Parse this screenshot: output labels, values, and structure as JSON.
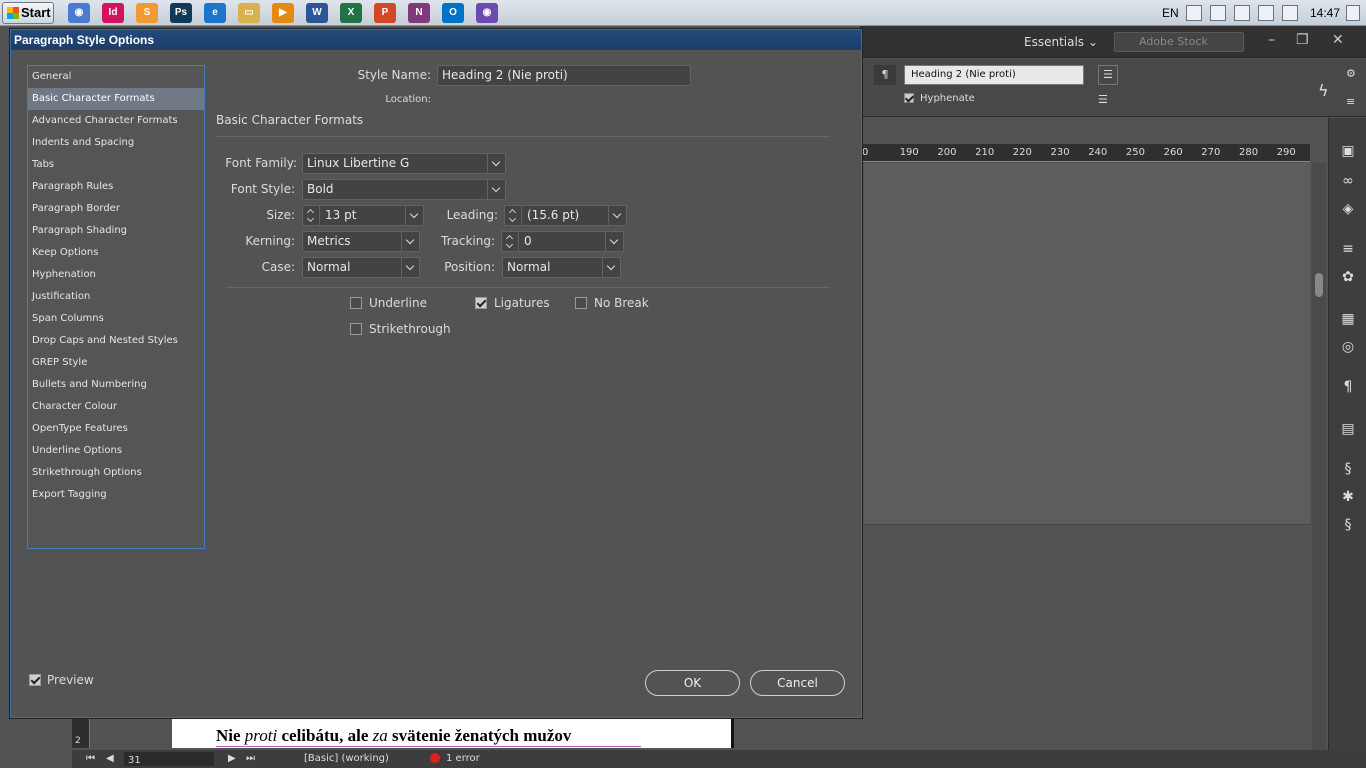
{
  "taskbar": {
    "start_label": "Start",
    "apps": [
      {
        "name": "chrome-icon",
        "glyph": "◉",
        "color": "#4a7bd0"
      },
      {
        "name": "indesign-icon",
        "glyph": "Id",
        "color": "#d4145a"
      },
      {
        "name": "sublime-icon",
        "glyph": "S",
        "color": "#f29a32"
      },
      {
        "name": "photoshop-icon",
        "glyph": "Ps",
        "color": "#0f3a5a"
      },
      {
        "name": "ie-icon",
        "glyph": "e",
        "color": "#1f75c9"
      },
      {
        "name": "explorer-icon",
        "glyph": "▭",
        "color": "#d8b24a"
      },
      {
        "name": "media-player-icon",
        "glyph": "▶",
        "color": "#e38a12"
      },
      {
        "name": "word-icon",
        "glyph": "W",
        "color": "#2b579a"
      },
      {
        "name": "excel-icon",
        "glyph": "X",
        "color": "#217346"
      },
      {
        "name": "powerpoint-icon",
        "glyph": "P",
        "color": "#d24726"
      },
      {
        "name": "onenote-icon",
        "glyph": "N",
        "color": "#80397b"
      },
      {
        "name": "outlook-icon",
        "glyph": "O",
        "color": "#0072c6"
      },
      {
        "name": "firefox-icon",
        "glyph": "◉",
        "color": "#6c4ab0"
      }
    ],
    "lang": "EN",
    "clock": "14:47"
  },
  "app": {
    "workspace": "Essentials",
    "stock_placeholder": "Adobe Stock",
    "style_name_field": "Heading 2 (Nie proti)",
    "hyphenate_label": "Hyphenate",
    "ruler_ticks": [
      "0",
      "190",
      "200",
      "210",
      "220",
      "230",
      "240",
      "250",
      "260",
      "270",
      "280",
      "290"
    ],
    "page_text_a": "Nie ",
    "page_text_b": "proti",
    "page_text_c": " celibátu, ale ",
    "page_text_d": "za",
    "page_text_e": " svätenie ženatých mužov",
    "page_number_mark": "2"
  },
  "status": {
    "page": "31",
    "style": "[Basic] (working)",
    "errors": "1 error"
  },
  "dialog": {
    "title": "Paragraph Style Options",
    "categories": [
      "General",
      "Basic Character Formats",
      "Advanced Character Formats",
      "Indents and Spacing",
      "Tabs",
      "Paragraph Rules",
      "Paragraph Border",
      "Paragraph Shading",
      "Keep Options",
      "Hyphenation",
      "Justification",
      "Span Columns",
      "Drop Caps and Nested Styles",
      "GREP Style",
      "Bullets and Numbering",
      "Character Colour",
      "OpenType Features",
      "Underline Options",
      "Strikethrough Options",
      "Export Tagging"
    ],
    "selected_category": "Basic Character Formats",
    "style_name_label": "Style Name:",
    "style_name_value": "Heading 2 (Nie proti)",
    "location_label": "Location:",
    "section_title": "Basic Character Formats",
    "font_family_label": "Font Family:",
    "font_family_value": "Linux Libertine G",
    "font_style_label": "Font Style:",
    "font_style_value": "Bold",
    "size_label": "Size:",
    "size_value": "13 pt",
    "leading_label": "Leading:",
    "leading_value": "(15.6 pt)",
    "kerning_label": "Kerning:",
    "kerning_value": "Metrics",
    "tracking_label": "Tracking:",
    "tracking_value": "0",
    "case_label": "Case:",
    "case_value": "Normal",
    "position_label": "Position:",
    "position_value": "Normal",
    "underline_label": "Underline",
    "underline_checked": false,
    "ligatures_label": "Ligatures",
    "ligatures_checked": true,
    "nobreak_label": "No Break",
    "nobreak_checked": false,
    "strikethrough_label": "Strikethrough",
    "strikethrough_checked": false,
    "preview_label": "Preview",
    "preview_checked": true,
    "ok_label": "OK",
    "cancel_label": "Cancel"
  }
}
